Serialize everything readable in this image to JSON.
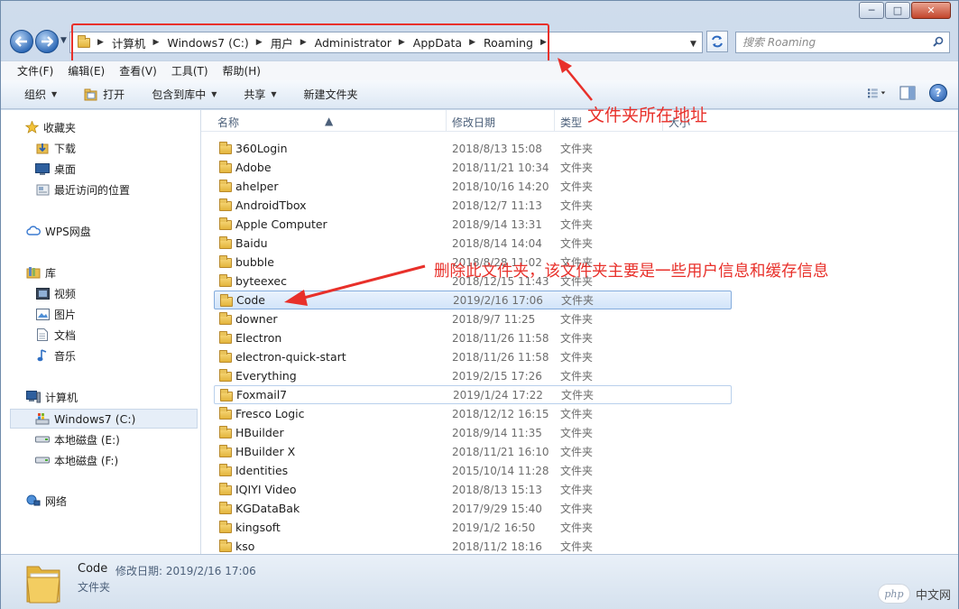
{
  "window": {
    "caption_buttons": [
      "─",
      "□",
      "✕"
    ]
  },
  "address": {
    "crumbs": [
      "计算机",
      "Windows7 (C:)",
      "用户",
      "Administrator",
      "AppData",
      "Roaming"
    ],
    "search_placeholder": "搜索 Roaming"
  },
  "menubar": [
    "文件(F)",
    "编辑(E)",
    "查看(V)",
    "工具(T)",
    "帮助(H)"
  ],
  "toolbar": {
    "organize": "组织",
    "open": "打开",
    "include_library": "包含到库中",
    "share": "共享",
    "new_folder": "新建文件夹"
  },
  "navpane": {
    "favorites": "收藏夹",
    "downloads": "下载",
    "desktop": "桌面",
    "recent": "最近访问的位置",
    "wps": "WPS网盘",
    "libraries": "库",
    "videos": "视频",
    "pictures": "图片",
    "documents": "文档",
    "music": "音乐",
    "computer": "计算机",
    "drive_c": "Windows7 (C:)",
    "drive_e": "本地磁盘 (E:)",
    "drive_f": "本地磁盘 (F:)",
    "network": "网络"
  },
  "columns": {
    "name": "名称",
    "modified": "修改日期",
    "type": "类型",
    "size": "大小"
  },
  "files": [
    {
      "name": "360Login",
      "date": "2018/8/13 15:08",
      "type": "文件夹"
    },
    {
      "name": "Adobe",
      "date": "2018/11/21 10:34",
      "type": "文件夹"
    },
    {
      "name": "ahelper",
      "date": "2018/10/16 14:20",
      "type": "文件夹"
    },
    {
      "name": "AndroidTbox",
      "date": "2018/12/7 11:13",
      "type": "文件夹"
    },
    {
      "name": "Apple Computer",
      "date": "2018/9/14 13:31",
      "type": "文件夹"
    },
    {
      "name": "Baidu",
      "date": "2018/8/14 14:04",
      "type": "文件夹"
    },
    {
      "name": "bubble",
      "date": "2018/8/28 11:02",
      "type": "文件夹"
    },
    {
      "name": "byteexec",
      "date": "2018/12/15 11:43",
      "type": "文件夹"
    },
    {
      "name": "Code",
      "date": "2019/2/16 17:06",
      "type": "文件夹"
    },
    {
      "name": "downer",
      "date": "2018/9/7 11:25",
      "type": "文件夹"
    },
    {
      "name": "Electron",
      "date": "2018/11/26 11:58",
      "type": "文件夹"
    },
    {
      "name": "electron-quick-start",
      "date": "2018/11/26 11:58",
      "type": "文件夹"
    },
    {
      "name": "Everything",
      "date": "2019/2/15 17:26",
      "type": "文件夹"
    },
    {
      "name": "Foxmail7",
      "date": "2019/1/24 17:22",
      "type": "文件夹"
    },
    {
      "name": "Fresco Logic",
      "date": "2018/12/12 16:15",
      "type": "文件夹"
    },
    {
      "name": "HBuilder",
      "date": "2018/9/14 11:35",
      "type": "文件夹"
    },
    {
      "name": "HBuilder X",
      "date": "2018/11/21 16:10",
      "type": "文件夹"
    },
    {
      "name": "Identities",
      "date": "2015/10/14 11:28",
      "type": "文件夹"
    },
    {
      "name": "IQIYI Video",
      "date": "2018/8/13 15:13",
      "type": "文件夹"
    },
    {
      "name": "KGDataBak",
      "date": "2017/9/29 15:40",
      "type": "文件夹"
    },
    {
      "name": "kingsoft",
      "date": "2019/1/2 16:50",
      "type": "文件夹"
    },
    {
      "name": "kso",
      "date": "2018/11/2 18:16",
      "type": "文件夹"
    }
  ],
  "annotations": {
    "address_note": "文件夹所在地址",
    "delete_note": "删除此文件夹，该文件夹主要是一些用户信息和缓存信息"
  },
  "details": {
    "name": "Code",
    "modified": "修改日期: 2019/2/16 17:06",
    "type": "文件夹"
  },
  "watermark": {
    "logo": "php",
    "text": "中文网"
  }
}
